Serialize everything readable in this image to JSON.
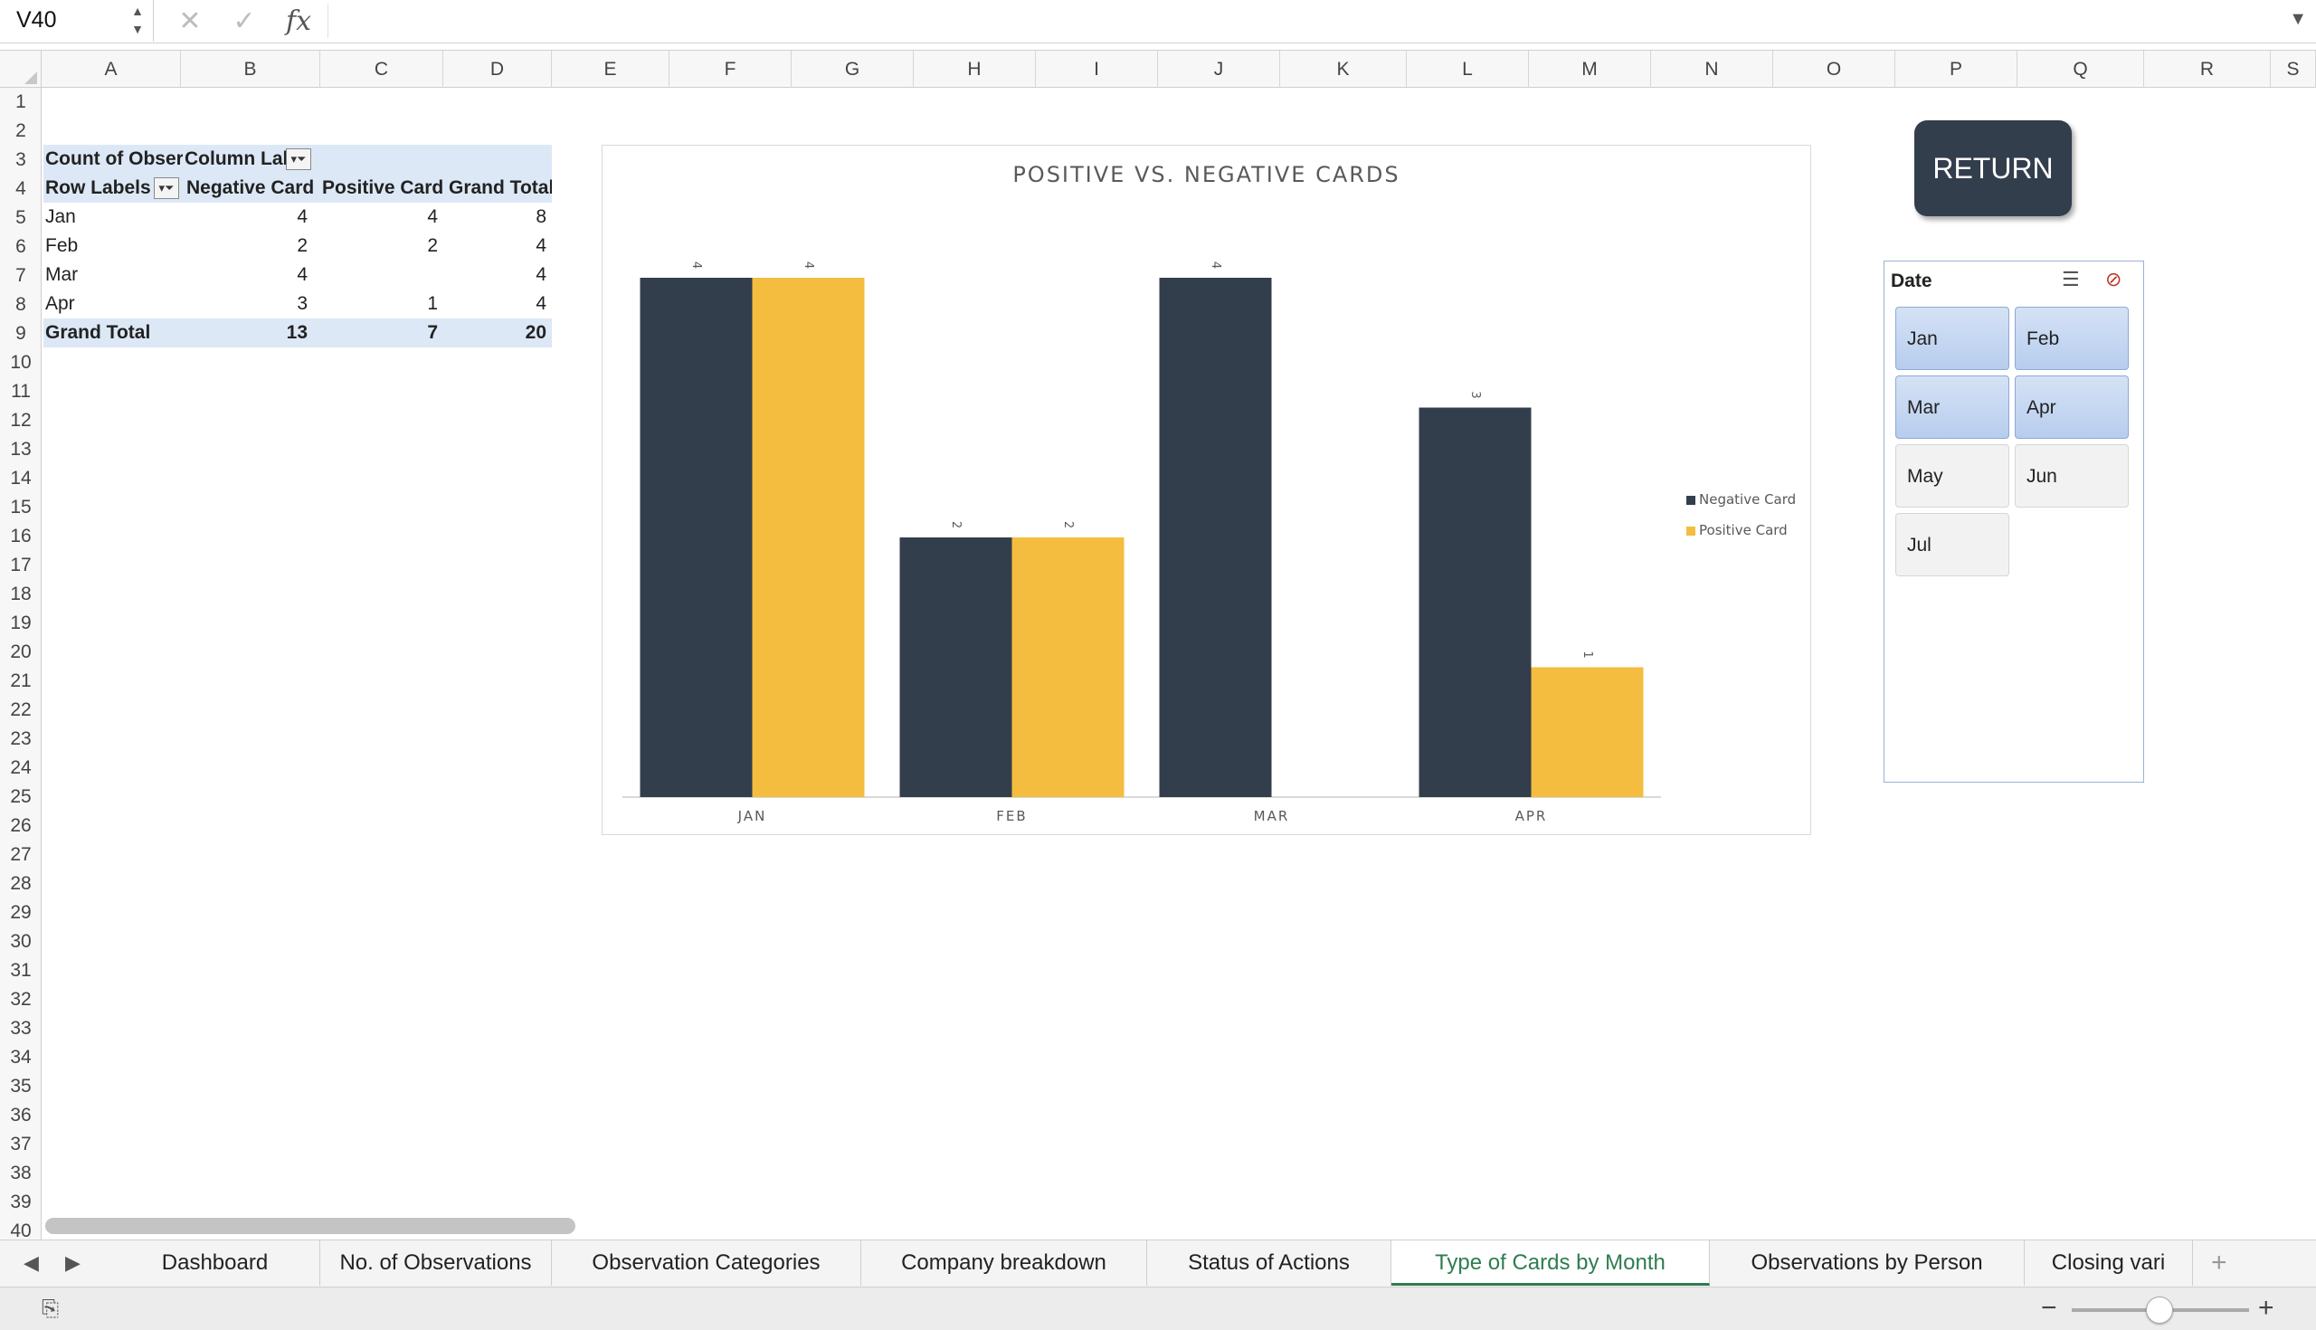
{
  "formula_bar": {
    "name_box": "V40",
    "cancel_icon": "close-icon",
    "confirm_icon": "check-icon",
    "function_label": "fx",
    "formula_value": ""
  },
  "columns": [
    "A",
    "B",
    "C",
    "D",
    "E",
    "F",
    "G",
    "H",
    "I",
    "J",
    "K",
    "L",
    "M",
    "N",
    "O",
    "P",
    "Q",
    "R",
    "S"
  ],
  "rows": [
    "1",
    "2",
    "3",
    "4",
    "5",
    "6",
    "7",
    "8",
    "9",
    "10",
    "11",
    "12",
    "13",
    "14",
    "15",
    "16",
    "17",
    "18",
    "19",
    "20",
    "21",
    "22",
    "23",
    "24",
    "25",
    "26",
    "27",
    "28",
    "29",
    "30",
    "31",
    "32",
    "33",
    "34",
    "35",
    "36",
    "37",
    "38",
    "39",
    "40"
  ],
  "pivot": {
    "values_header": "Count of Observation",
    "column_labels": "Column Labels",
    "row_labels": "Row Labels",
    "headers": [
      "Negative Card",
      "Positive Card",
      "Grand Total"
    ],
    "rows": [
      {
        "label": "Jan",
        "negative": "4",
        "positive": "4",
        "total": "8"
      },
      {
        "label": "Feb",
        "negative": "2",
        "positive": "2",
        "total": "4"
      },
      {
        "label": "Mar",
        "negative": "4",
        "positive": "",
        "total": "4"
      },
      {
        "label": "Apr",
        "negative": "3",
        "positive": "1",
        "total": "4"
      }
    ],
    "grand_total": {
      "label": "Grand Total",
      "negative": "13",
      "positive": "7",
      "total": "20"
    }
  },
  "chart_data": {
    "type": "bar",
    "title": "POSITIVE VS. NEGATIVE CARDS",
    "categories": [
      "JAN",
      "FEB",
      "MAR",
      "APR"
    ],
    "series": [
      {
        "name": "Negative Card",
        "color": "#333e4d",
        "values": [
          4,
          2,
          4,
          3
        ]
      },
      {
        "name": "Positive Card",
        "color": "#f4bd3f",
        "values": [
          4,
          2,
          null,
          1
        ]
      }
    ],
    "ylim": [
      0,
      4
    ],
    "grid": false,
    "legend": "right",
    "data_labels": true
  },
  "return_button": "RETURN",
  "slicer": {
    "title": "Date",
    "items": [
      {
        "label": "Jan",
        "selected": true
      },
      {
        "label": "Feb",
        "selected": true
      },
      {
        "label": "Mar",
        "selected": true
      },
      {
        "label": "Apr",
        "selected": true
      },
      {
        "label": "May",
        "selected": false
      },
      {
        "label": "Jun",
        "selected": false
      },
      {
        "label": "Jul",
        "selected": false
      }
    ]
  },
  "sheet_tabs": [
    {
      "label": "Dashboard",
      "active": false
    },
    {
      "label": "No. of Observations",
      "active": false
    },
    {
      "label": "Observation Categories",
      "active": false
    },
    {
      "label": "Company breakdown",
      "active": false
    },
    {
      "label": "Status of Actions",
      "active": false
    },
    {
      "label": "Type of Cards by Month",
      "active": true
    },
    {
      "label": "Observations by Person",
      "active": false
    },
    {
      "label": "Closing vari",
      "active": false
    }
  ],
  "status_bar": {
    "zoom_out": "−",
    "zoom_in": "+"
  }
}
